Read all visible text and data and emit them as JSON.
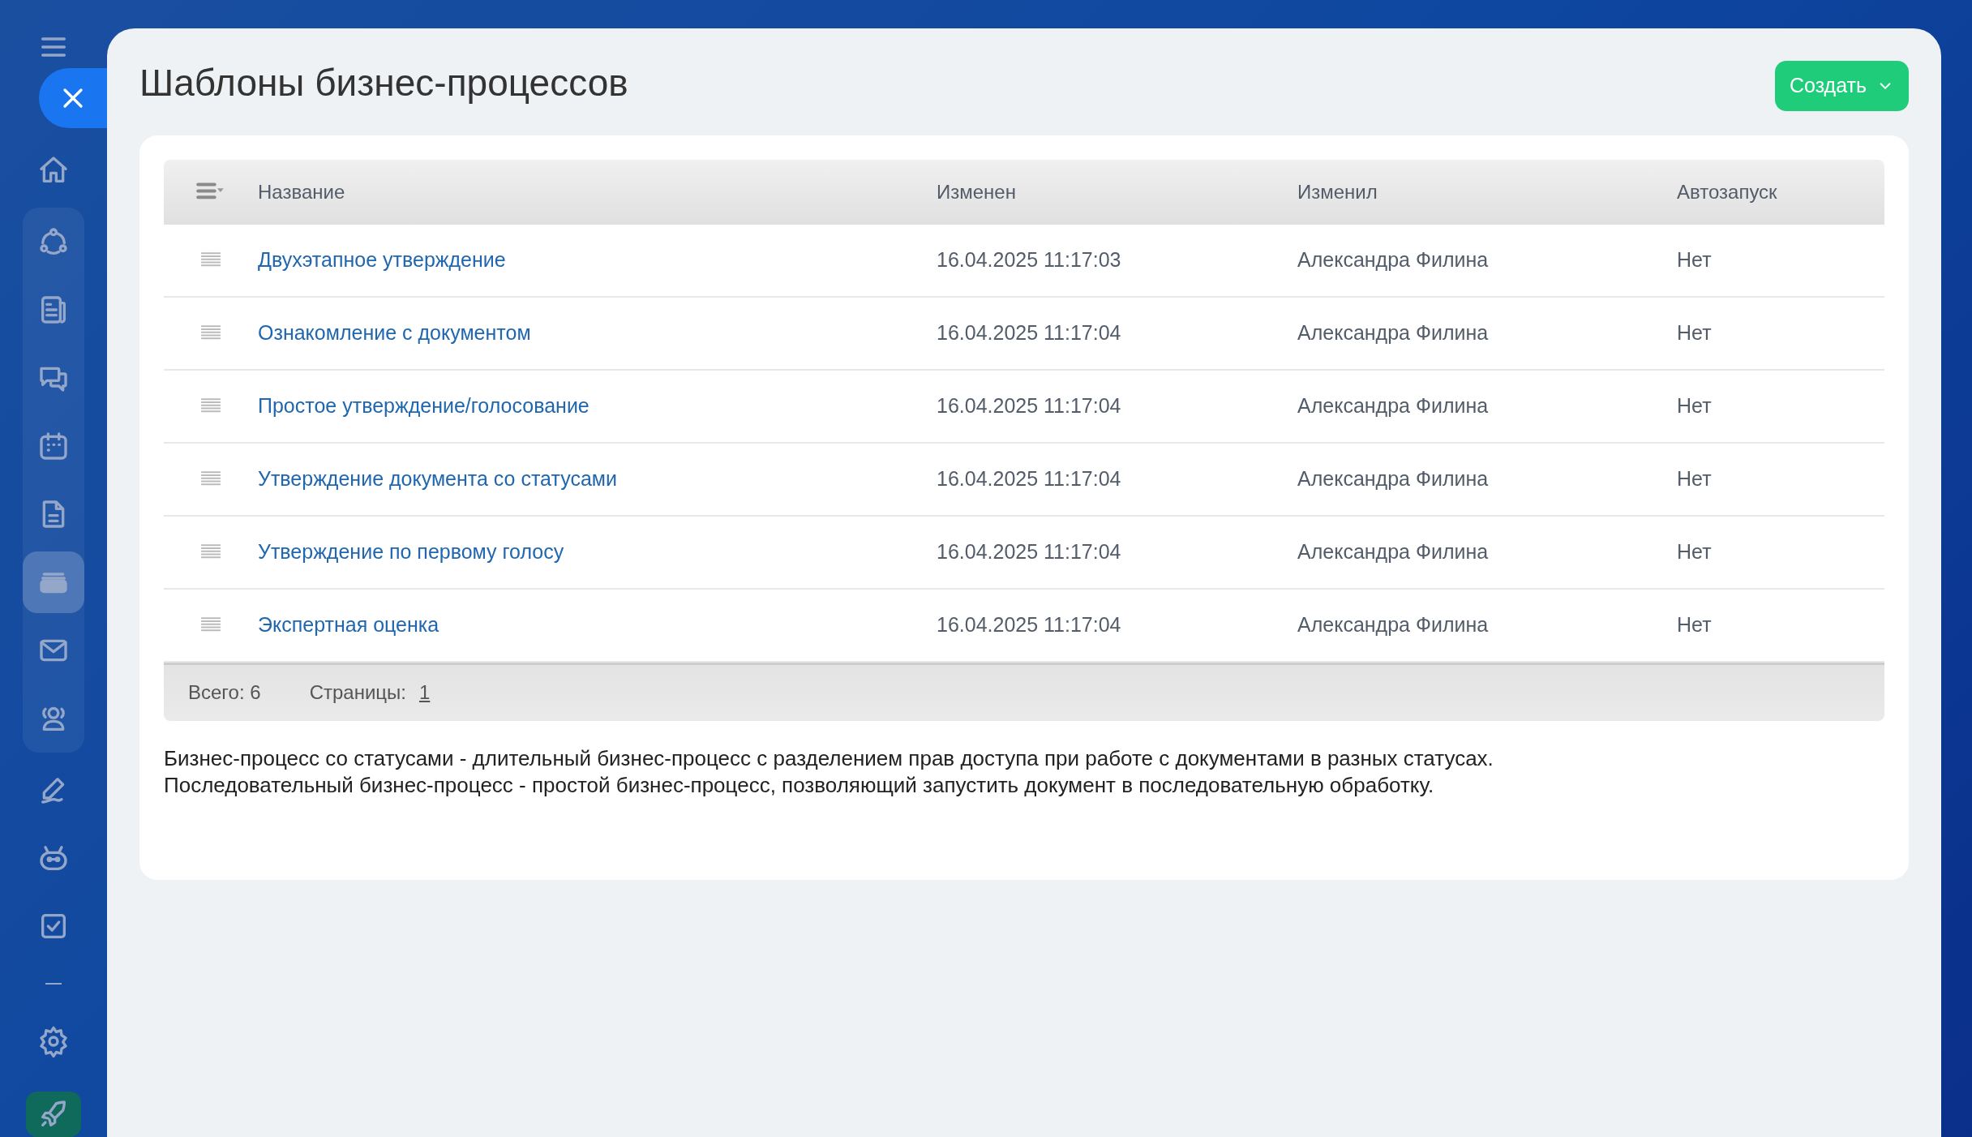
{
  "sidebar": {
    "items": [
      {
        "selected": false
      },
      {
        "selected": false
      },
      {
        "selected": false
      },
      {
        "selected": false
      },
      {
        "selected": false
      },
      {
        "selected": false
      },
      {
        "selected": true
      },
      {
        "selected": false
      },
      {
        "selected": false
      },
      {
        "selected": false
      },
      {
        "selected": false
      },
      {
        "selected": false
      }
    ]
  },
  "page": {
    "title": "Шаблоны бизнес-процессов",
    "create_button": "Создать"
  },
  "table": {
    "columns": [
      "Название",
      "Изменен",
      "Изменил",
      "Автозапуск"
    ],
    "rows": [
      {
        "name": "Двухэтапное утверждение",
        "modified": "16.04.2025 11:17:03",
        "modified_by": "Александра Филина",
        "autorun": "Нет"
      },
      {
        "name": "Ознакомление с документом",
        "modified": "16.04.2025 11:17:04",
        "modified_by": "Александра Филина",
        "autorun": "Нет"
      },
      {
        "name": "Простое утверждение/голосование",
        "modified": "16.04.2025 11:17:04",
        "modified_by": "Александра Филина",
        "autorun": "Нет"
      },
      {
        "name": "Утверждение документа со статусами",
        "modified": "16.04.2025 11:17:04",
        "modified_by": "Александра Филина",
        "autorun": "Нет"
      },
      {
        "name": "Утверждение по первому голосу",
        "modified": "16.04.2025 11:17:04",
        "modified_by": "Александра Филина",
        "autorun": "Нет"
      },
      {
        "name": "Экспертная оценка",
        "modified": "16.04.2025 11:17:04",
        "modified_by": "Александра Филина",
        "autorun": "Нет"
      }
    ],
    "footer": {
      "total": "Всего: 6",
      "pages_label": "Страницы:",
      "page": "1"
    }
  },
  "notes": [
    "Бизнес-процесс со статусами - длительный бизнес-процесс с разделением прав доступа при работе с документами в разных статусах.",
    "Последовательный бизнес-процесс - простой бизнес-процесс, позволяющий запустить документ в последовательную обработку."
  ]
}
